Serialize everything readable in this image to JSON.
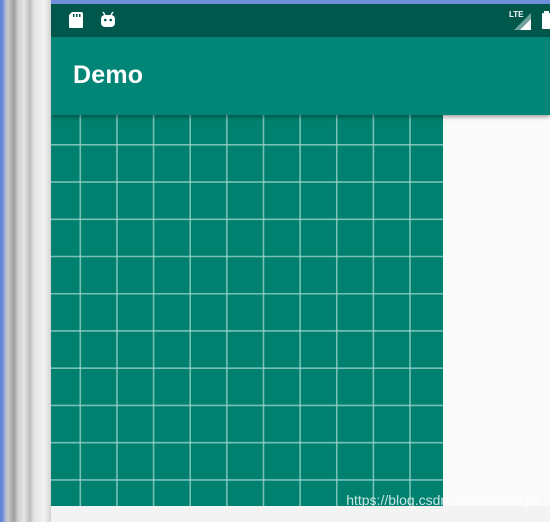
{
  "app": {
    "title": "Demo"
  },
  "status_bar": {
    "left_icons": [
      "sd-card-icon",
      "android-debug-icon"
    ],
    "right_icons": [
      "lte-signal-icon",
      "battery-icon"
    ],
    "network_label": "LTE"
  },
  "grid_view": {
    "columns": 11,
    "rows": 11,
    "background_color": "#00806f",
    "line_color": "#9fd6cc"
  },
  "colors": {
    "status_bar": "#00574b",
    "app_bar": "#008577",
    "screen_background": "#fafafa"
  },
  "watermark": {
    "text": "https://blog.csdn.net/liulanzaijia"
  }
}
